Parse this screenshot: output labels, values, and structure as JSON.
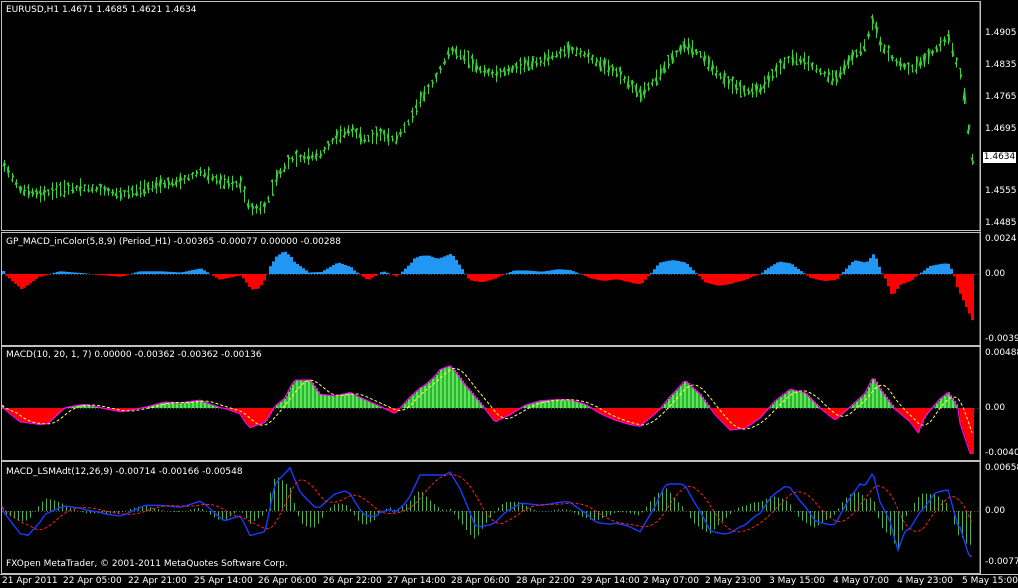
{
  "panels": {
    "price": {
      "title": "EURUSD,H1  1.4671 1.4685 1.4621 1.4634",
      "y_ticks": [
        "1.4905",
        "1.4835",
        "1.4765",
        "1.4695",
        "1.4625",
        "1.4555",
        "1.4485"
      ],
      "current_price": "1.4634",
      "bar_color": "#3fcf3f"
    },
    "gp_macd": {
      "title": "GP_MACD_inColor(5,8,9) (Period_H1) -0.00365 -0.00077 0.00000 -0.00288",
      "y_ticks": [
        "0.0024",
        "0.00",
        "-0.00394"
      ],
      "positive_color": "#2196f3",
      "negative_color": "#ff0000"
    },
    "macd": {
      "title": "MACD(10, 20, 1, 7) 0.00000 -0.00362 -0.00362 -0.00136",
      "y_ticks": [
        "0.00488",
        "0.00",
        "-0.00403"
      ],
      "positive_color": "#2db62d",
      "negative_color": "#ff0000",
      "line_color": "#ff00ff",
      "signal_color": "#ffff66"
    },
    "lsma": {
      "title": "MACD_LSMAdt(12,26,9) -0.00714 -0.00166 -0.00548",
      "y_ticks": [
        "0.00658",
        "0.00",
        "-0.00779"
      ],
      "hist_color": "#4caf50",
      "line_color": "#1a3cff",
      "signal_color": "#ff2020"
    }
  },
  "x_axis": [
    "21 Apr 2011",
    "22 Apr 05:00",
    "22 Apr 21:00",
    "25 Apr 14:00",
    "26 Apr 06:00",
    "26 Apr 22:00",
    "27 Apr 14:00",
    "28 Apr 06:00",
    "28 Apr 22:00",
    "29 Apr 14:00",
    "2 May 07:00",
    "2 May 23:00",
    "3 May 15:00",
    "4 May 07:00",
    "4 May 23:00",
    "5 May 15:00"
  ],
  "watermark": "FXOpen MetaTrader, © 2001-2011 MetaQuotes Software Corp."
}
